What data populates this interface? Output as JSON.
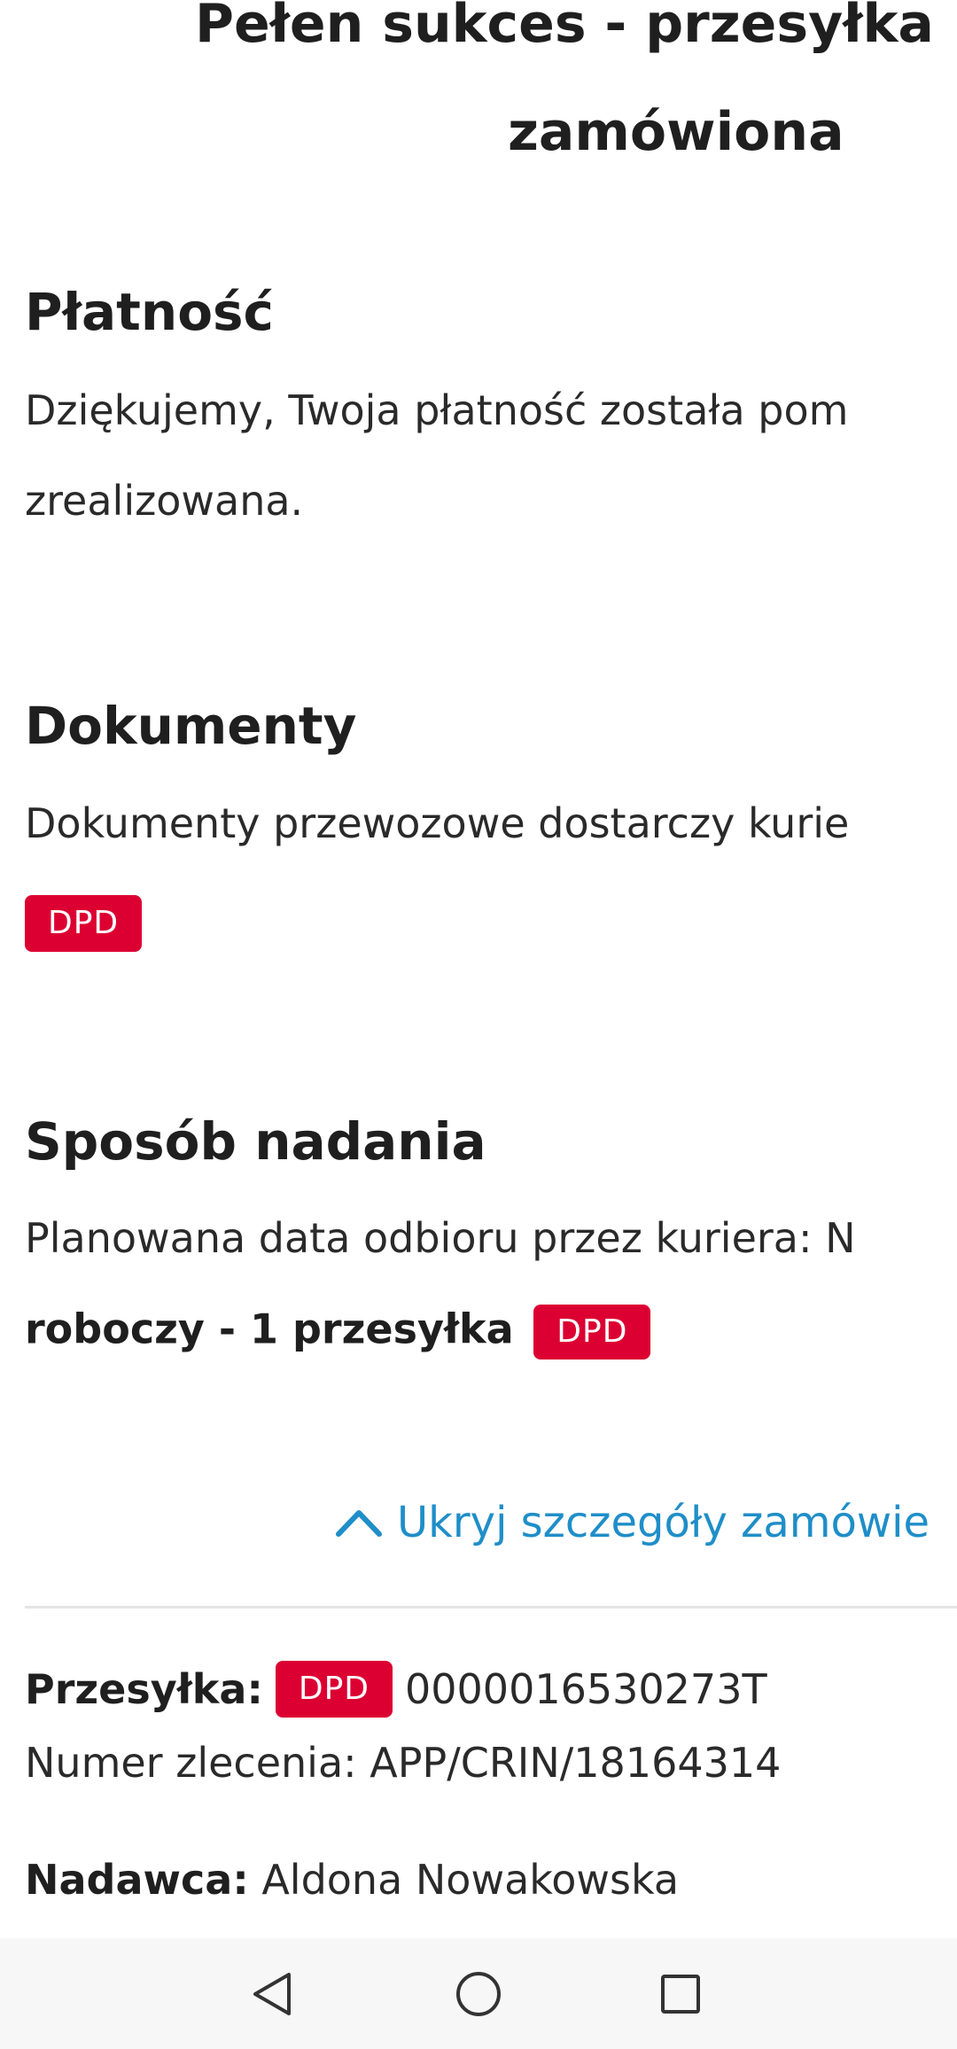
{
  "title": {
    "line1_partial": "Pełen sukces - przesyłka",
    "line2": "zamówiona"
  },
  "payment": {
    "heading": "Płatność",
    "text_line1": "Dziękujemy, Twoja płatność została pom",
    "text_line2": "zrealizowana."
  },
  "documents": {
    "heading": "Dokumenty",
    "text": "Dokumenty przewozowe dostarczy kurie",
    "badge": "DPD"
  },
  "shipping_method": {
    "heading": "Sposób nadania",
    "text_line1": "Planowana data odbioru przez kuriera: N",
    "text_line2_bold": "roboczy - 1 przesyłka",
    "badge": "DPD"
  },
  "toggle": {
    "label": "Ukryj szczegóły zamówie",
    "icon": "chevron-up-icon"
  },
  "order_details": {
    "shipment_label": "Przesyłka:",
    "shipment_badge": "DPD",
    "shipment_number": "0000016530273T",
    "order_number_text": "Numer zlecenia: APP/CRIN/18164314",
    "sender_label": "Nadawca:",
    "sender_name": "Aldona Nowakowska"
  },
  "navbar": {
    "back_icon": "back-triangle-icon",
    "home_icon": "home-circle-icon",
    "recents_icon": "recents-square-icon"
  },
  "colors": {
    "dpd_red": "#dc0032",
    "link_blue": "#1f8ec8",
    "text_dark": "#1f1f1f",
    "navbar_bg": "#f7f7f7"
  }
}
